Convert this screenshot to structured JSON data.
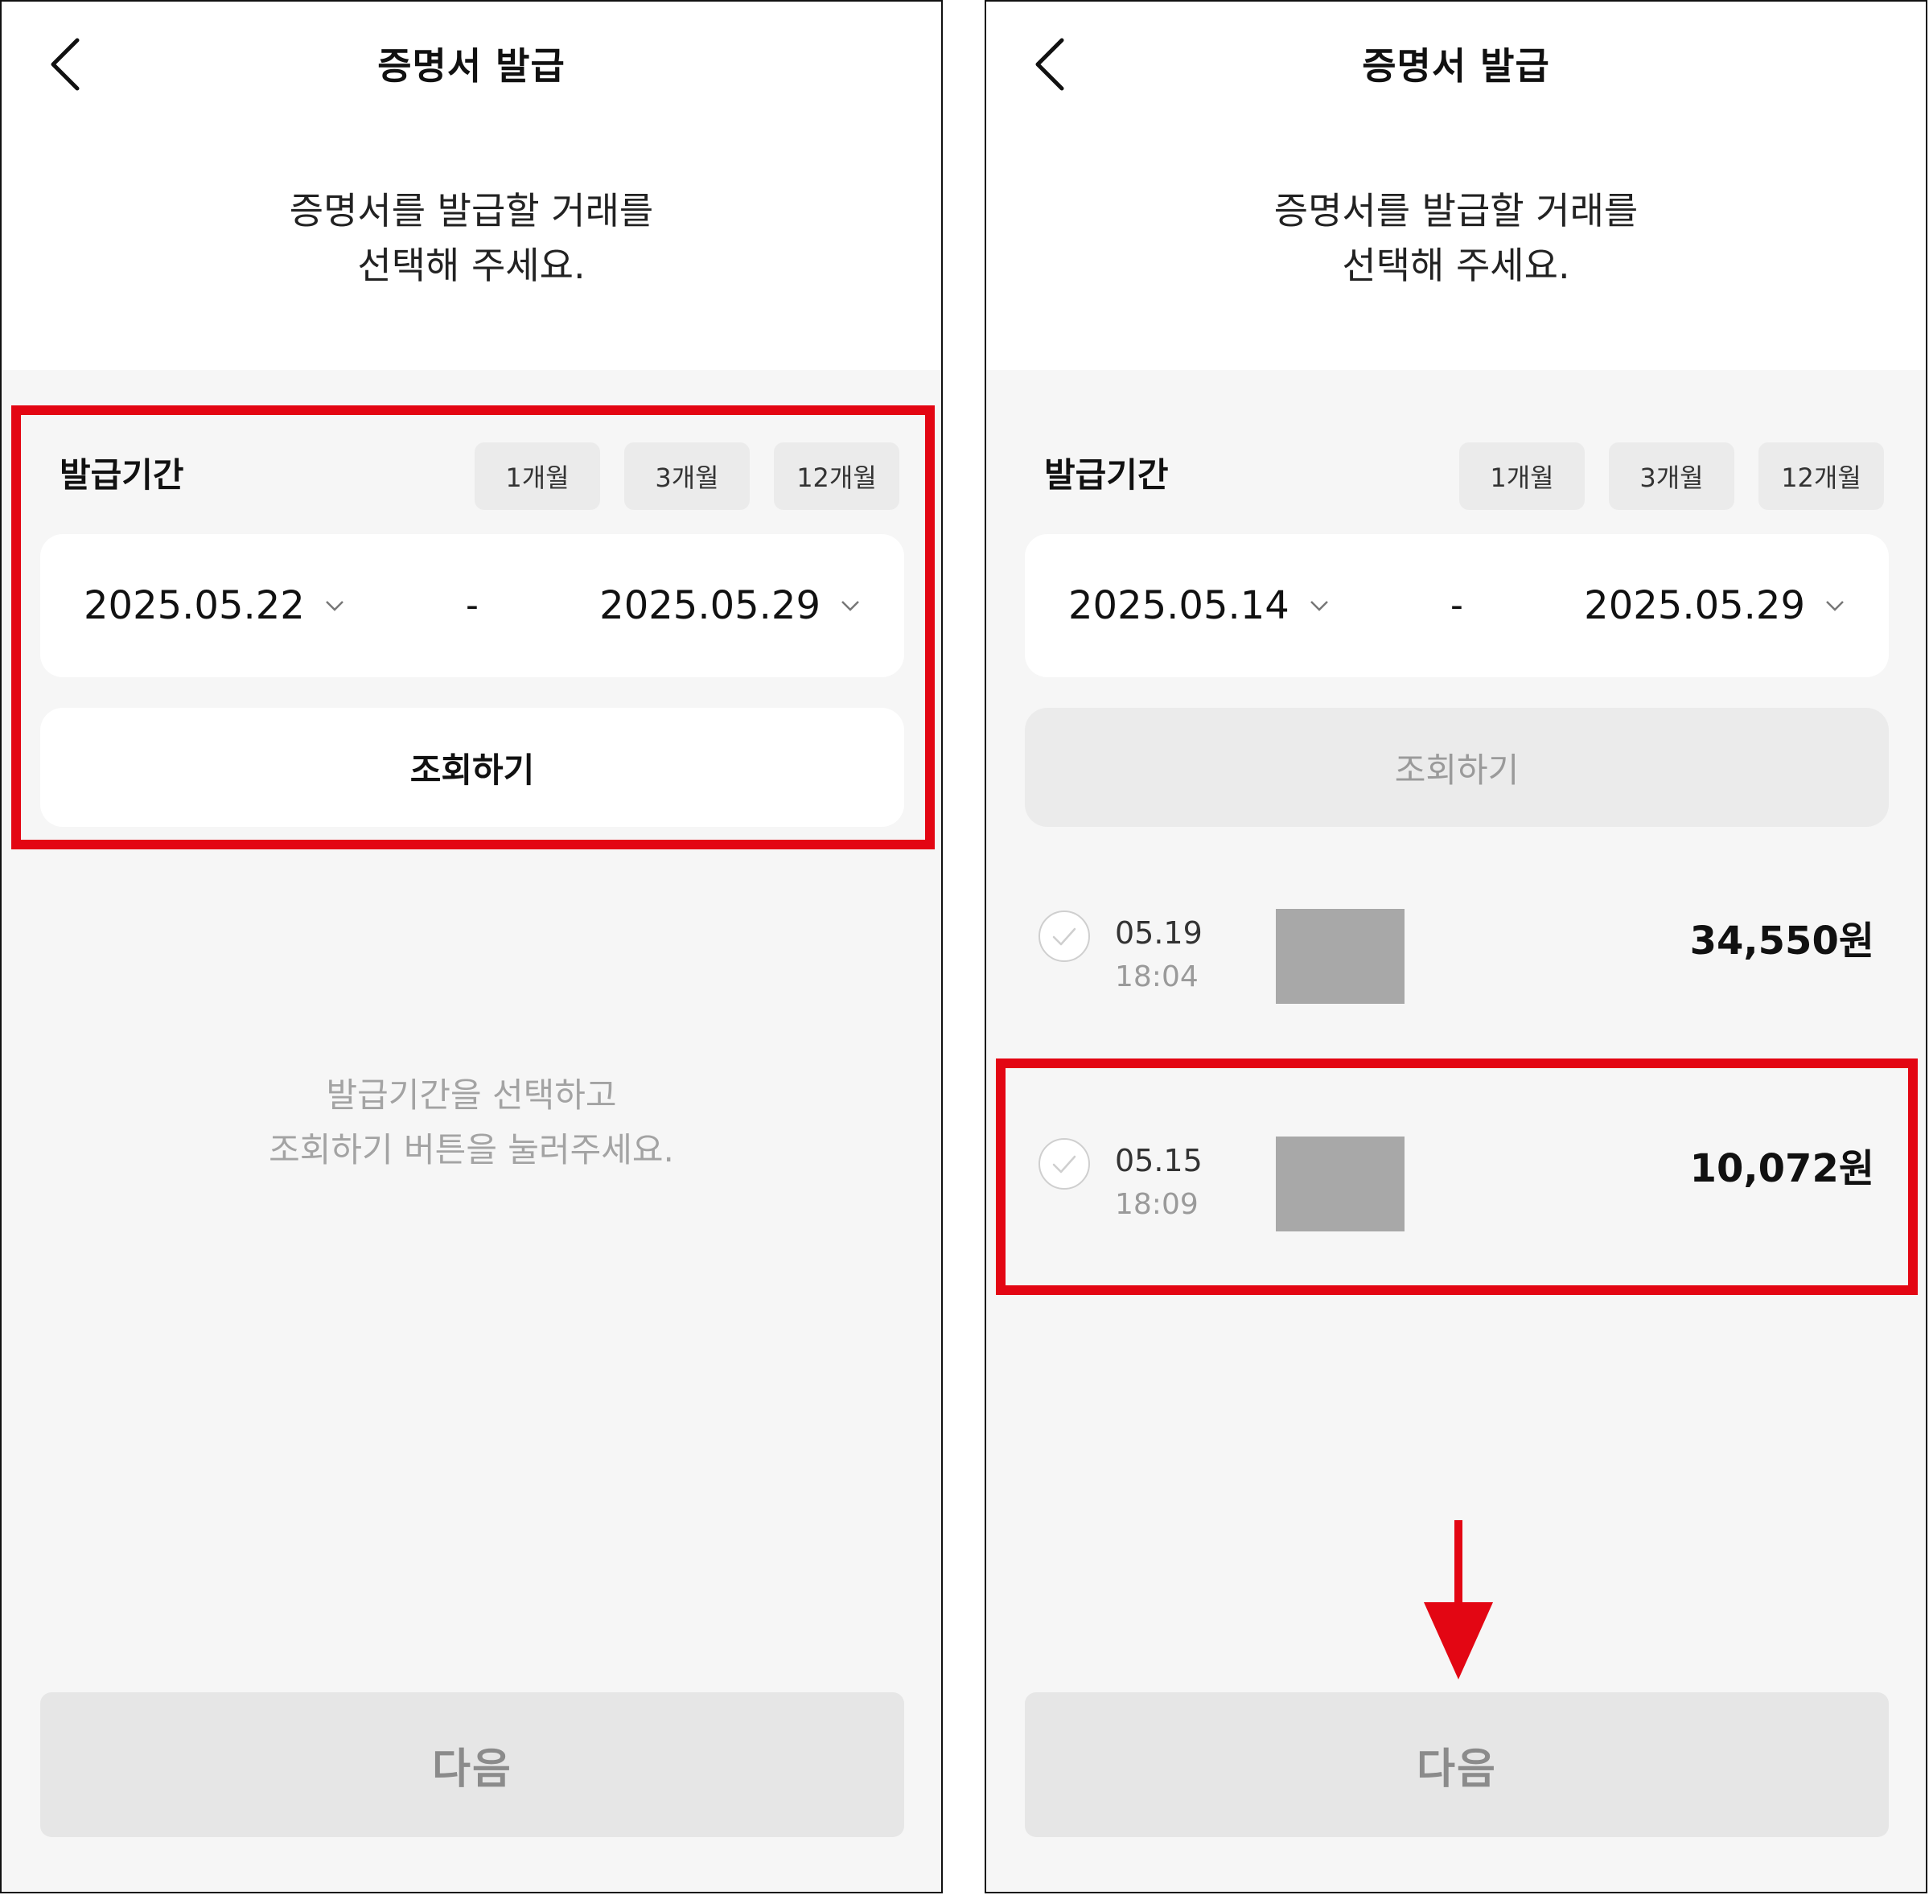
{
  "left": {
    "title": "증명서 발급",
    "subtitle_line1": "증명서를 발급할 거래를",
    "subtitle_line2": "선택해 주세요.",
    "period_label": "발급기간",
    "period_chips": [
      "1개월",
      "3개월",
      "12개월"
    ],
    "start_date": "2025.05.22",
    "end_date": "2025.05.29",
    "separator": "-",
    "query_button": "조회하기",
    "empty_line1": "발급기간을 선택하고",
    "empty_line2": "조회하기 버튼을 눌러주세요.",
    "next_button": "다음"
  },
  "right": {
    "title": "증명서 발급",
    "subtitle_line1": "증명서를 발급할 거래를",
    "subtitle_line2": "선택해 주세요.",
    "period_label": "발급기간",
    "period_chips": [
      "1개월",
      "3개월",
      "12개월"
    ],
    "start_date": "2025.05.14",
    "end_date": "2025.05.29",
    "separator": "-",
    "query_button": "조회하기",
    "transactions": [
      {
        "date": "05.19",
        "time": "18:04",
        "amount": "34,550원"
      },
      {
        "date": "05.15",
        "time": "18:09",
        "amount": "10,072원"
      }
    ],
    "next_button": "다음"
  },
  "icons": {
    "back": "chevron-left-icon",
    "dropdown": "chevron-down-icon",
    "check": "check-circle-icon",
    "annotation_arrow": "arrow-down-icon"
  },
  "colors": {
    "highlight": "#e30613",
    "background_gray": "#f6f6f6",
    "chip_gray": "#ebebeb",
    "disabled_text": "#9a9a9a"
  }
}
